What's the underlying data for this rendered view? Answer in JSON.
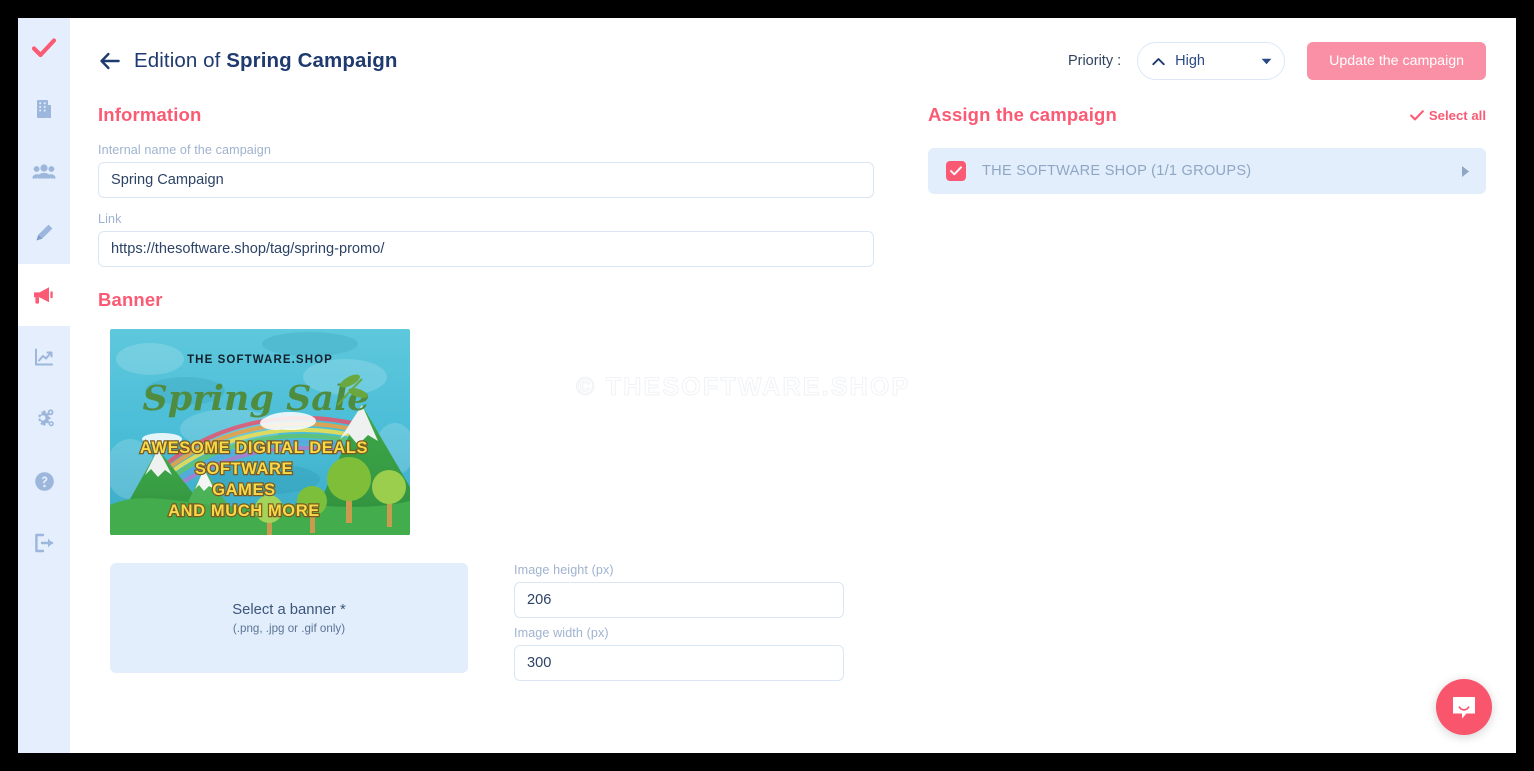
{
  "sidebar": {
    "items": [
      {
        "name": "logo-check-icon",
        "icon": "check-logo",
        "active": false
      },
      {
        "name": "sidebar-item-company",
        "icon": "building",
        "active": false
      },
      {
        "name": "sidebar-item-users",
        "icon": "users",
        "active": false
      },
      {
        "name": "sidebar-item-editor",
        "icon": "pen",
        "active": false
      },
      {
        "name": "sidebar-item-campaigns",
        "icon": "megaphone",
        "active": true
      },
      {
        "name": "sidebar-item-stats",
        "icon": "chart",
        "active": false
      },
      {
        "name": "sidebar-item-settings",
        "icon": "gears",
        "active": false
      },
      {
        "name": "sidebar-item-help",
        "icon": "question",
        "active": false
      },
      {
        "name": "sidebar-item-logout",
        "icon": "logout",
        "active": false
      }
    ]
  },
  "header": {
    "back_icon": "arrow-left-icon",
    "title_prefix": "Edition of ",
    "title_name": "Spring Campaign",
    "priority_label": "Priority :",
    "priority_value": "High",
    "priority_caret_icon": "caret-up-icon",
    "priority_arrow_icon": "chevron-down-icon",
    "update_button": "Update the campaign"
  },
  "information": {
    "heading": "Information",
    "name_label": "Internal name of the campaign",
    "name_value": "Spring Campaign",
    "name_placeholder": "Internal name of the campaign",
    "link_label": "Link",
    "link_value": "https://thesoftware.shop/tag/spring-promo/",
    "link_placeholder": "Link"
  },
  "banner": {
    "heading": "Banner",
    "image_alt": "Spring Sale banner preview",
    "image_text": {
      "brand": "THE SOFTWARE.SHOP",
      "headline": "Spring Sale",
      "line1": "AWESOME DIGITAL DEALS",
      "line2": "SOFTWARE",
      "line3": "GAMES",
      "line4": "AND MUCH MORE"
    },
    "dropzone_title": "Select a banner *",
    "dropzone_sub": "(.png, .jpg or .gif only)",
    "height_label": "Image height (px)",
    "height_value": "206",
    "width_label": "Image width (px)",
    "width_value": "300"
  },
  "assign": {
    "heading": "Assign the campaign",
    "select_all_label": "Select all",
    "select_all_icon": "check-icon",
    "groups": [
      {
        "label": "THE SOFTWARE SHOP (1/1 GROUPS)",
        "checked": true,
        "expand_icon": "caret-right-icon"
      }
    ]
  },
  "watermark": "© THESOFTWARE.SHOP",
  "intercom": {
    "icon": "chat-bubble-icon"
  },
  "colors": {
    "accent_pink": "#fb5a74",
    "accent_pink_muted": "#fa90a5",
    "sidebar_bg": "#e4eefc",
    "panel_blue": "#e2eefc",
    "title_navy": "#1f3a6e",
    "label_gray": "#9fb3cf"
  }
}
